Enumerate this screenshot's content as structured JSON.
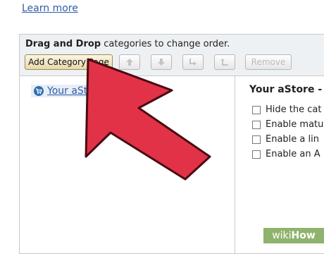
{
  "top_link": "Learn more",
  "toolbar": {
    "instruction_bold": "Drag and Drop",
    "instruction_rest": " categories to change order.",
    "add_category_label": "Add Category Page",
    "remove_label": "Remove"
  },
  "tree": {
    "root_label": "Your aStore"
  },
  "right_panel": {
    "title": "Your aStore -",
    "options": [
      "Hide the cat",
      "Enable matu",
      "Enable a lin",
      "Enable an A"
    ]
  },
  "watermark": {
    "part1": "wiki",
    "part2": "How"
  },
  "colors": {
    "arrow": "#e23248",
    "link": "#2f5ea8",
    "toolbar_bg": "#eef1f4",
    "watermark_bg": "#8fb36c"
  }
}
